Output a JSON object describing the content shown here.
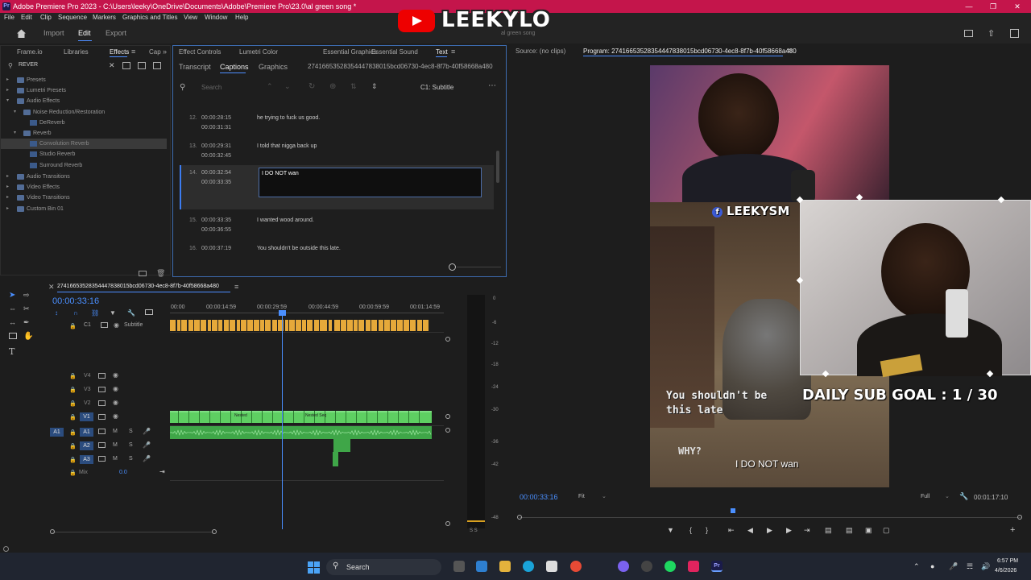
{
  "titlebar": {
    "title": "Adobe Premiere Pro 2023 - C:\\Users\\leeky\\OneDrive\\Documents\\Adobe\\Premiere Pro\\23.0\\al green song *"
  },
  "menu": [
    "File",
    "Edit",
    "Clip",
    "Sequence",
    "Markers",
    "Graphics and Titles",
    "View",
    "Window",
    "Help"
  ],
  "watermark": {
    "name": "LEEKYLO",
    "sub": "al green song"
  },
  "workspace": {
    "home": "Home",
    "import": "Import",
    "edit": "Edit",
    "export": "Export"
  },
  "effects_panel": {
    "tabs": [
      "Frame.io",
      "Libraries",
      "Effects",
      "Cap"
    ],
    "search_value": "REVER",
    "tree": [
      {
        "label": "Presets",
        "type": "folder"
      },
      {
        "label": "Lumetri Presets",
        "type": "folder"
      },
      {
        "label": "Audio Effects",
        "type": "folder"
      },
      {
        "label": "Noise Reduction/Restoration",
        "type": "folder"
      },
      {
        "label": "DeReverb",
        "type": "fx"
      },
      {
        "label": "Reverb",
        "type": "folder"
      },
      {
        "label": "Convolution Reverb",
        "type": "fx"
      },
      {
        "label": "Studio Reverb",
        "type": "fx"
      },
      {
        "label": "Surround Reverb",
        "type": "fx"
      },
      {
        "label": "Audio Transitions",
        "type": "folder"
      },
      {
        "label": "Video Effects",
        "type": "folder"
      },
      {
        "label": "Video Transitions",
        "type": "folder"
      },
      {
        "label": "Custom Bin 01",
        "type": "folder"
      }
    ]
  },
  "captions_panel": {
    "top_tabs": [
      "Effect Controls",
      "Lumetri Color",
      "Essential Graphics",
      "Essential Sound",
      "Text"
    ],
    "sub_tabs": [
      "Transcript",
      "Captions",
      "Graphics"
    ],
    "sequence_name": "27416653528354447838015bcd06730-4ec8-8f7b-40f58668a480",
    "search_placeholder": "Search",
    "track": "C1: Subtitle",
    "rows": [
      {
        "num": "12.",
        "in": "00:00:28:15",
        "out": "00:00:31:31",
        "text": "he trying to fuck us good."
      },
      {
        "num": "13.",
        "in": "00:00:29:31",
        "out": "00:00:32:45",
        "text": "I told that nigga back up"
      },
      {
        "num": "14.",
        "in": "00:00:32:54",
        "out": "00:00:33:35",
        "text": "I DO NOT wan"
      },
      {
        "num": "15.",
        "in": "00:00:33:35",
        "out": "00:00:36:55",
        "text": "I wanted wood around."
      },
      {
        "num": "16.",
        "in": "00:00:37:19",
        "out": "",
        "text": "You shouldn't be outside this late."
      }
    ]
  },
  "monitors": {
    "source_label": "Source: (no clips)",
    "program_label": "Program: 27416653528354447838015bcd06730-4ec8-8f7b-40f58668a480",
    "current_time": "00:00:33:16",
    "fit": "Fit",
    "full": "Full",
    "duration": "00:01:17:10"
  },
  "overlay": {
    "social": "LEEKYSM",
    "game_sub": "You shouldn't be\nthis late",
    "goal": "DAILY SUB GOAL : 1 / 30",
    "why": "WHY?",
    "caption": "I DO NOT wan"
  },
  "timeline": {
    "seq_name": "27416653528354447838015bcd06730-4ec8-8f7b-40f58668a480",
    "timecode": "00:00:33:16",
    "ruler": [
      "00:00",
      "00:00:14:59",
      "00:00:29:59",
      "00:00:44:59",
      "00:00:59:59",
      "00:01:14:59"
    ],
    "tracks": {
      "c1": "C1",
      "subtitle": "Subtitle",
      "v4": "V4",
      "v3": "V3",
      "v2": "V2",
      "v1": "V1",
      "a1": "A1",
      "a2": "A2",
      "a3": "A3",
      "mix": "Mix",
      "mix_val": "0.0"
    },
    "nested_labels": [
      "Nested",
      "Nested Seq"
    ],
    "meter_ticks": [
      "0",
      "-6",
      "-12",
      "-18",
      "-24",
      "-30",
      "-36",
      "-42",
      "-48"
    ],
    "meter_s": "S  S"
  },
  "taskbar": {
    "search": "Search",
    "time": "6:57 PM",
    "date": "4/6/2026"
  }
}
